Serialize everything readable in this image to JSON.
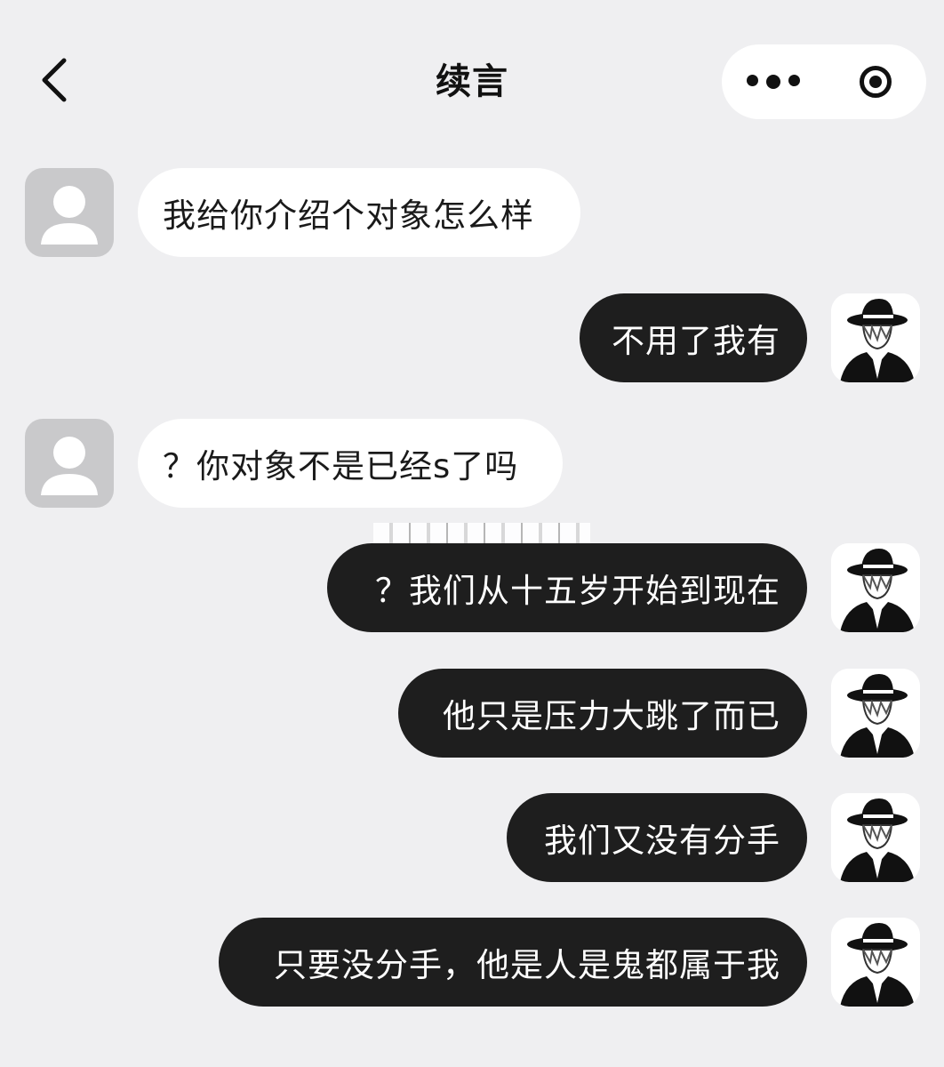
{
  "header": {
    "title": "续言",
    "back_icon": "chevron-left-icon",
    "more_icon": "more-dots-icon",
    "close_icon": "target-circle-icon"
  },
  "messages": [
    {
      "side": "in",
      "text": "我给你介绍个对象怎么样"
    },
    {
      "side": "out",
      "text": "不用了我有"
    },
    {
      "side": "in",
      "text": "？你对象不是已经s了吗"
    },
    {
      "side": "out",
      "text": "？我们从十五岁开始到现在"
    },
    {
      "side": "out",
      "text": "他只是压力大跳了而已"
    },
    {
      "side": "out",
      "text": "我们又没有分手"
    },
    {
      "side": "out",
      "text": "只要没分手，他是人是鬼都属于我"
    }
  ],
  "colors": {
    "background": "#efeff1",
    "incoming_bubble": "#ffffff",
    "outgoing_bubble": "#1e1e1e",
    "default_avatar": "#c9c9cb"
  }
}
